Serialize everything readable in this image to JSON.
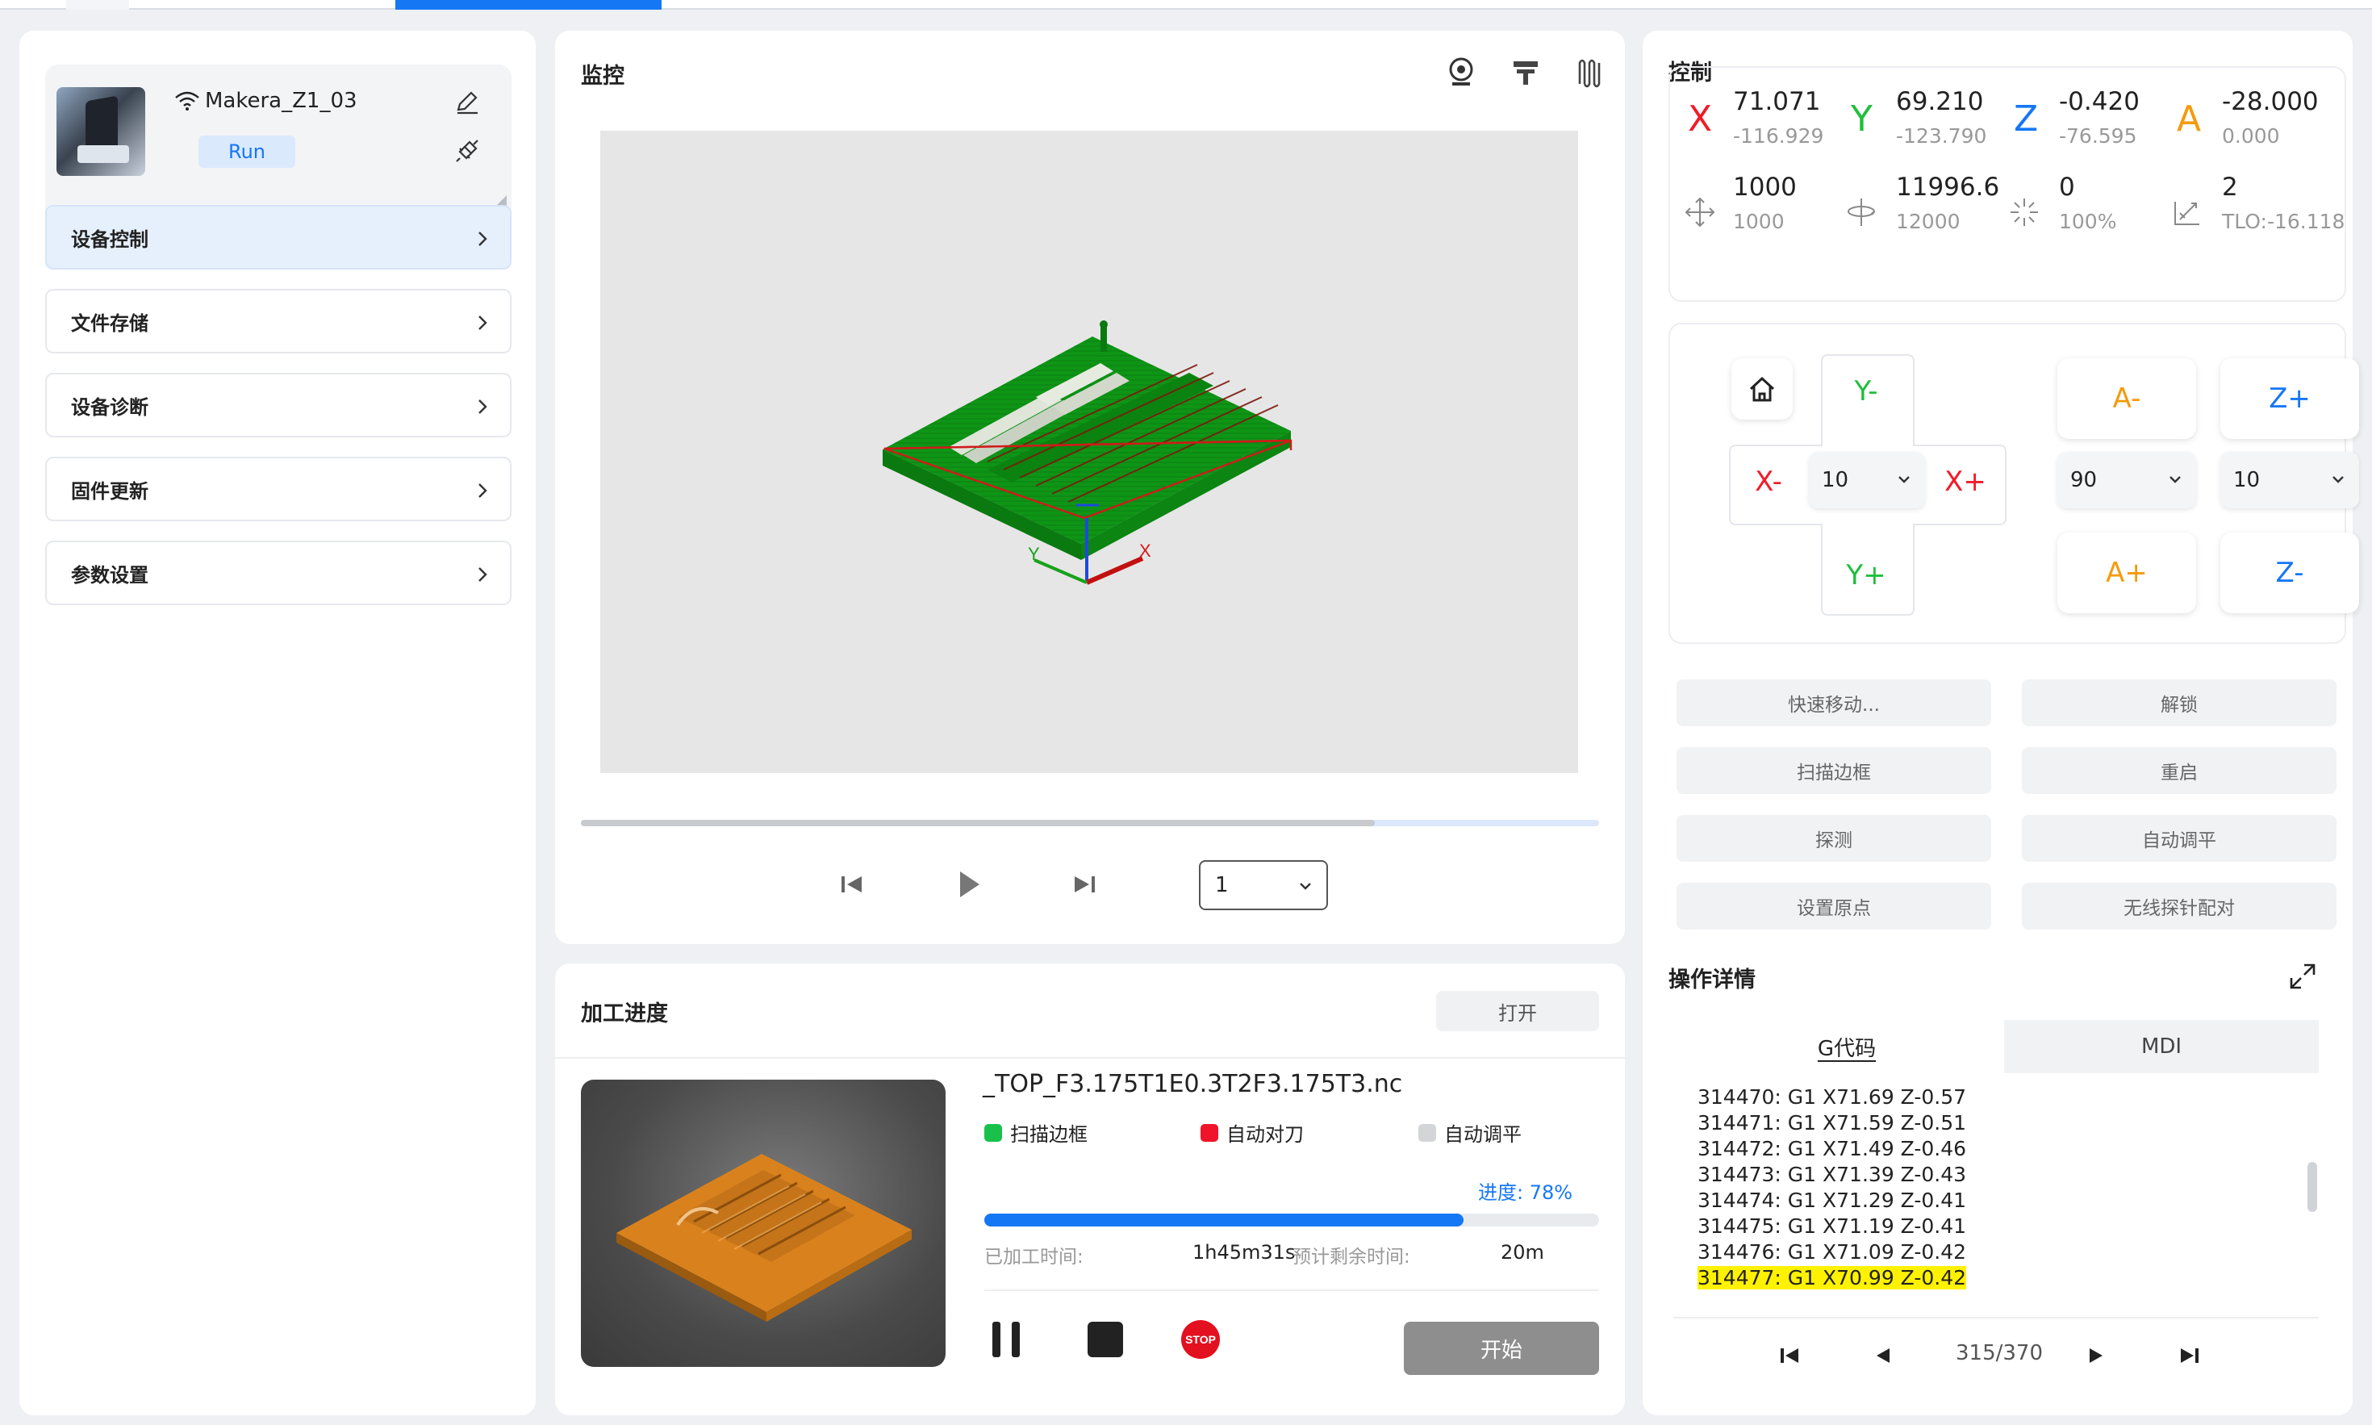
{
  "device": {
    "name": "Makera_Z1_03",
    "status": "Run"
  },
  "nav": [
    {
      "label": "设备控制"
    },
    {
      "label": "文件存储"
    },
    {
      "label": "设备诊断"
    },
    {
      "label": "固件更新"
    },
    {
      "label": "参数设置"
    }
  ],
  "monitor": {
    "title": "监控",
    "playback_value": "1",
    "scrub_progress": 0.78
  },
  "progress": {
    "title": "加工进度",
    "open_label": "打开",
    "file_name": "_TOP_F3.175T1E0.3T2F3.175T3.nc",
    "status": [
      {
        "label": "扫描边框",
        "color": "#19c14a"
      },
      {
        "label": "自动对刀",
        "color": "#f0142a"
      },
      {
        "label": "自动调平",
        "color": "#d3d5d8"
      }
    ],
    "progress_label": "进度:  78%",
    "progress_value": 0.78,
    "elapsed_label": "已加工时间:",
    "elapsed_value": "1h45m31s",
    "remaining_label": "预计剩余时间:",
    "remaining_value": "20m",
    "start_label": "开始",
    "stop_text": "STOP"
  },
  "control": {
    "title": "控制",
    "axes": [
      {
        "letter": "X",
        "value": "71.071",
        "sub": "-116.929",
        "color": "#f01c28"
      },
      {
        "letter": "Y",
        "value": "69.210",
        "sub": "-123.790",
        "color": "#1fbf3a"
      },
      {
        "letter": "Z",
        "value": "-0.420",
        "sub": "-76.595",
        "color": "#1677f5"
      },
      {
        "letter": "A",
        "value": "-28.000",
        "sub": "0.000",
        "color": "#f59a0c"
      }
    ],
    "aux": [
      {
        "icon": "feed-rate-icon",
        "value": "1000",
        "sub": "1000"
      },
      {
        "icon": "spindle-icon",
        "value": "11996.6",
        "sub": "12000"
      },
      {
        "icon": "laser-icon",
        "value": "0",
        "sub": "100%"
      },
      {
        "icon": "tool-icon",
        "value": "2",
        "sub": "TLO:-16.118"
      }
    ],
    "jog": {
      "y_minus": "Y-",
      "y_plus": "Y+",
      "x_minus": "X-",
      "x_plus": "X+",
      "xy_step": "10",
      "a_minus": "A-",
      "a_plus": "A+",
      "a_step": "90",
      "z_plus": "Z+",
      "z_minus": "Z-",
      "z_step": "10"
    },
    "actions": [
      "快速移动...",
      "解锁",
      "扫描边框",
      "重启",
      "探测",
      "自动调平",
      "设置原点",
      "无线探针配对"
    ]
  },
  "details": {
    "title": "操作详情",
    "tabs": [
      "G代码",
      "MDI"
    ],
    "gcode_lines": [
      "314470: G1 X71.69 Z-0.57",
      "314471: G1 X71.59 Z-0.51",
      "314472: G1 X71.49 Z-0.46",
      "314473: G1 X71.39 Z-0.43",
      "314474: G1 X71.29 Z-0.41",
      "314475: G1 X71.19 Z-0.41",
      "314476: G1 X71.09 Z-0.42",
      "314477: G1 X70.99 Z-0.42"
    ],
    "page": "315/370"
  },
  "colors": {
    "accent": "#1677f5",
    "model_green": "#0d8f12"
  }
}
